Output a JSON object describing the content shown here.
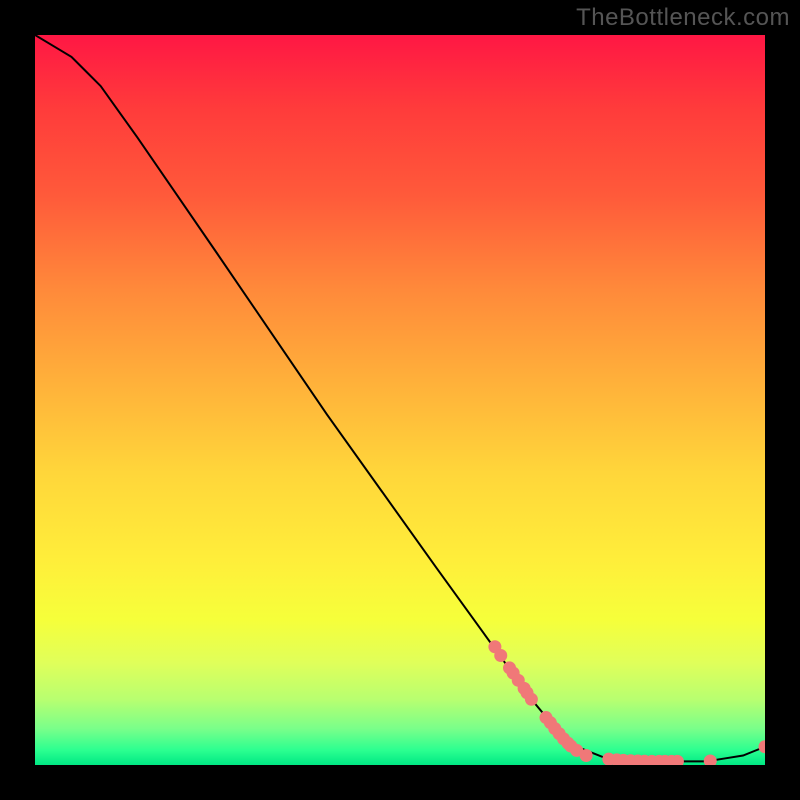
{
  "branding": "TheBottleneck.com",
  "chart_data": {
    "type": "line",
    "title": "",
    "xlabel": "",
    "ylabel": "",
    "xlim": [
      0,
      100
    ],
    "ylim": [
      0,
      100
    ],
    "curve": [
      {
        "x": 0,
        "y": 100
      },
      {
        "x": 5,
        "y": 97
      },
      {
        "x": 9,
        "y": 93
      },
      {
        "x": 14,
        "y": 86
      },
      {
        "x": 25,
        "y": 70
      },
      {
        "x": 40,
        "y": 48
      },
      {
        "x": 55,
        "y": 27
      },
      {
        "x": 68,
        "y": 9
      },
      {
        "x": 73,
        "y": 3
      },
      {
        "x": 78,
        "y": 1
      },
      {
        "x": 85,
        "y": 0.5
      },
      {
        "x": 92,
        "y": 0.5
      },
      {
        "x": 97,
        "y": 1.3
      },
      {
        "x": 100,
        "y": 2.5
      }
    ],
    "points": [
      {
        "x": 63,
        "y": 16.2
      },
      {
        "x": 63.8,
        "y": 15
      },
      {
        "x": 65,
        "y": 13.3
      },
      {
        "x": 65.5,
        "y": 12.6
      },
      {
        "x": 66.2,
        "y": 11.6
      },
      {
        "x": 67,
        "y": 10.5
      },
      {
        "x": 67.4,
        "y": 9.9
      },
      {
        "x": 68,
        "y": 9
      },
      {
        "x": 70,
        "y": 6.5
      },
      {
        "x": 70.6,
        "y": 5.8
      },
      {
        "x": 71.2,
        "y": 5
      },
      {
        "x": 71.8,
        "y": 4.3
      },
      {
        "x": 72.4,
        "y": 3.6
      },
      {
        "x": 73,
        "y": 3
      },
      {
        "x": 73.4,
        "y": 2.6
      },
      {
        "x": 74.2,
        "y": 2
      },
      {
        "x": 75.5,
        "y": 1.3
      },
      {
        "x": 78.6,
        "y": 0.8
      },
      {
        "x": 79.7,
        "y": 0.7
      },
      {
        "x": 80.6,
        "y": 0.63
      },
      {
        "x": 81.6,
        "y": 0.58
      },
      {
        "x": 82.6,
        "y": 0.55
      },
      {
        "x": 83.5,
        "y": 0.52
      },
      {
        "x": 84.5,
        "y": 0.5
      },
      {
        "x": 85.5,
        "y": 0.5
      },
      {
        "x": 86.3,
        "y": 0.5
      },
      {
        "x": 87.2,
        "y": 0.5
      },
      {
        "x": 88,
        "y": 0.5
      },
      {
        "x": 92.5,
        "y": 0.55
      },
      {
        "x": 100,
        "y": 2.5
      }
    ],
    "colors": {
      "curve": "#000000",
      "point_fill": "#f07878",
      "point_stroke": "#d85858"
    }
  }
}
